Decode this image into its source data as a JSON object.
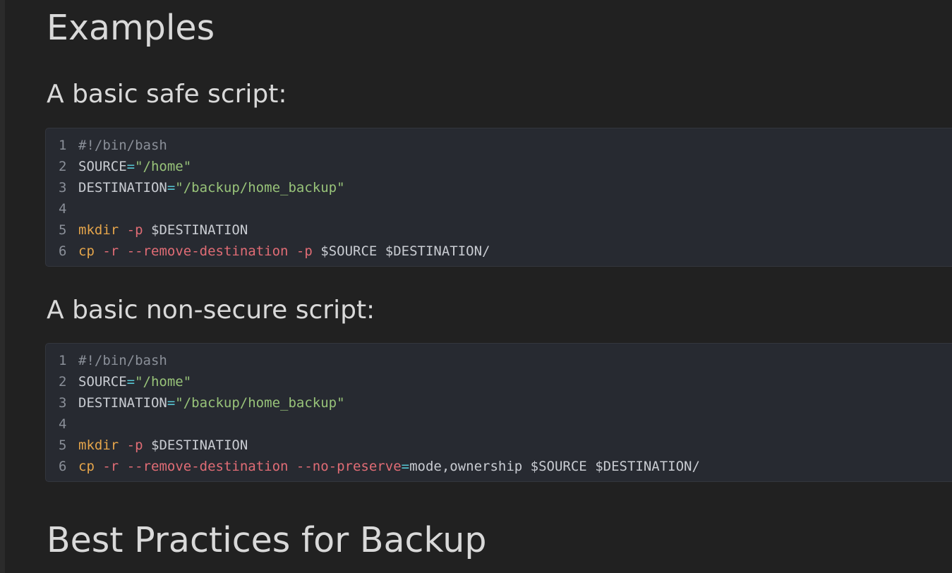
{
  "headings": {
    "examples": "Examples",
    "safe": "A basic safe script:",
    "nonsecure": "A basic non-secure script:",
    "best_practices": "Best Practices for Backup"
  },
  "safe_script": {
    "lines": [
      {
        "num": "1",
        "comment": "#!/bin/bash"
      },
      {
        "num": "2",
        "var": "SOURCE",
        "op": "=",
        "str": "\"/home\""
      },
      {
        "num": "3",
        "var": "DESTINATION",
        "op": "=",
        "str": "\"/backup/home_backup\""
      },
      {
        "num": "4"
      },
      {
        "num": "5",
        "cmd": "mkdir",
        "flag1": "-p",
        "rest": "$DESTINATION"
      },
      {
        "num": "6",
        "cmd": "cp",
        "flag1": "-r",
        "flag2": "--remove-destination",
        "flag3": "-p",
        "rest": "$SOURCE $DESTINATION/"
      }
    ]
  },
  "nonsecure_script": {
    "lines": [
      {
        "num": "1",
        "comment": "#!/bin/bash"
      },
      {
        "num": "2",
        "var": "SOURCE",
        "op": "=",
        "str": "\"/home\""
      },
      {
        "num": "3",
        "var": "DESTINATION",
        "op": "=",
        "str": "\"/backup/home_backup\""
      },
      {
        "num": "4"
      },
      {
        "num": "5",
        "cmd": "mkdir",
        "flag1": "-p",
        "rest": "$DESTINATION"
      },
      {
        "num": "6",
        "cmd": "cp",
        "flag1": "-r",
        "flag2": "--remove-destination",
        "flag3": "--no-preserve",
        "op": "=",
        "rest": "mode,ownership $SOURCE $DESTINATION/"
      }
    ]
  }
}
